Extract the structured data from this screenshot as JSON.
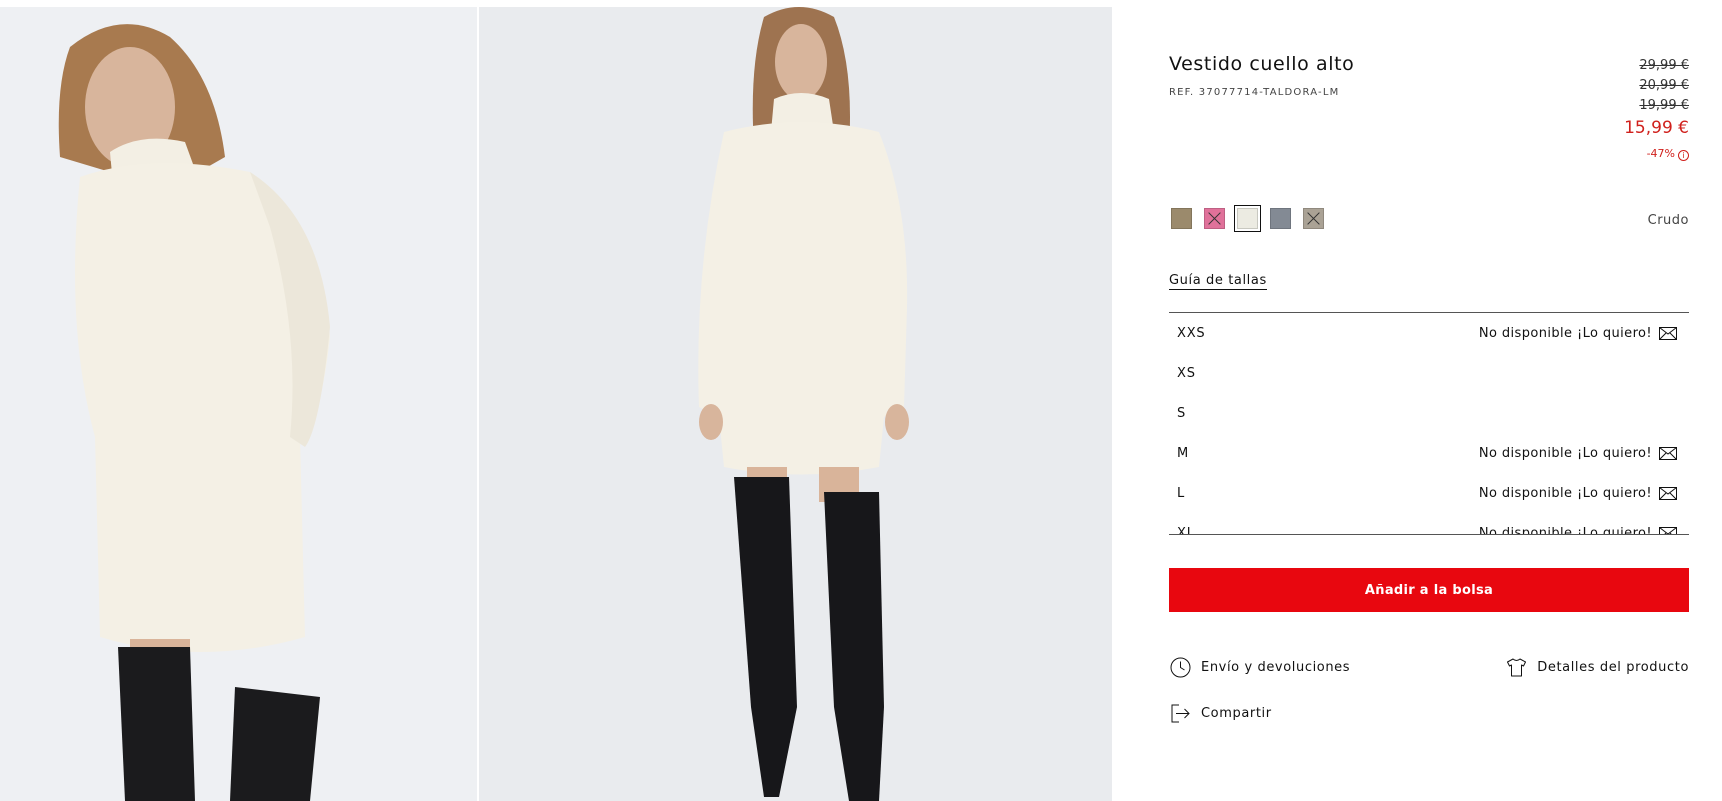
{
  "gallery": {
    "images": [
      {
        "alt": "model-closeup-cream-turtleneck-dress"
      },
      {
        "alt": "model-full-body-cream-turtleneck-dress"
      }
    ]
  },
  "product": {
    "title": "Vestido cuello alto",
    "reference": "REF. 37077714-TALDORA-LM",
    "prices": {
      "old": [
        "29,99 €",
        "20,99 €",
        "19,99 €"
      ],
      "current": "15,99 €",
      "discount": "-47%"
    },
    "colors": {
      "selected_name": "Crudo",
      "swatches": [
        {
          "color": "#9b8a6c",
          "available": true,
          "selected": false
        },
        {
          "color": "#e0719a",
          "available": false,
          "selected": false
        },
        {
          "color": "#ecebe2",
          "available": true,
          "selected": true
        },
        {
          "color": "#838a94",
          "available": true,
          "selected": false
        },
        {
          "color": "#aaa295",
          "available": false,
          "selected": false
        }
      ]
    },
    "size_guide": "Guía de tallas",
    "sizes": [
      {
        "label": "XXS",
        "status": "No disponible ¡Lo quiero!"
      },
      {
        "label": "XS",
        "status": ""
      },
      {
        "label": "S",
        "status": ""
      },
      {
        "label": "M",
        "status": "No disponible ¡Lo quiero!"
      },
      {
        "label": "L",
        "status": "No disponible ¡Lo quiero!"
      },
      {
        "label": "XL",
        "status": "No disponible ¡Lo quiero!"
      }
    ],
    "add_to_bag": "Añadir a la bolsa",
    "links": {
      "shipping": "Envío y devoluciones",
      "details": "Detalles del producto",
      "share": "Compartir"
    }
  },
  "colors": {
    "accent_red": "#e8070f",
    "sale_red": "#d0201c"
  }
}
